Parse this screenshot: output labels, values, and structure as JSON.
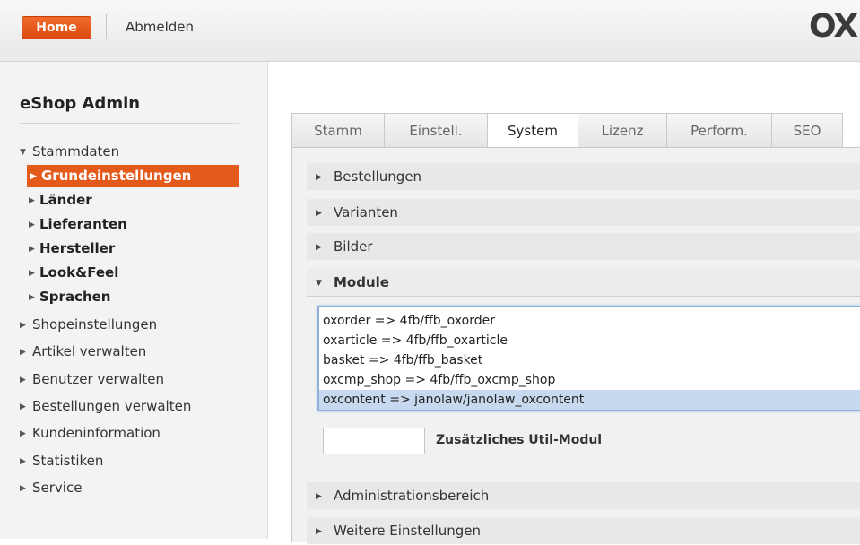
{
  "topbar": {
    "home_label": "Home",
    "logout_label": "Abmelden",
    "logo_text": "OX"
  },
  "sidebar": {
    "title": "eShop Admin",
    "section": {
      "label": "Stammdaten",
      "expanded": true
    },
    "sub_items": [
      {
        "label": "Grundeinstellungen",
        "active": true
      },
      {
        "label": "Länder"
      },
      {
        "label": "Lieferanten"
      },
      {
        "label": "Hersteller"
      },
      {
        "label": "Look&Feel"
      },
      {
        "label": "Sprachen"
      }
    ],
    "items": [
      {
        "label": "Shopeinstellungen"
      },
      {
        "label": "Artikel verwalten"
      },
      {
        "label": "Benutzer verwalten"
      },
      {
        "label": "Bestellungen verwalten"
      },
      {
        "label": "Kundeninformation"
      },
      {
        "label": "Statistiken"
      },
      {
        "label": "Service"
      }
    ]
  },
  "tabs": [
    {
      "label": "Stamm"
    },
    {
      "label": "Einstell."
    },
    {
      "label": "System",
      "active": true
    },
    {
      "label": "Lizenz"
    },
    {
      "label": "Perform."
    },
    {
      "label": "SEO"
    }
  ],
  "groups": {
    "bestellungen": "Bestellungen",
    "varianten": "Varianten",
    "bilder": "Bilder",
    "module": "Module",
    "administrationsbereich": "Administrationsbereich",
    "weitere": "Weitere Einstellungen"
  },
  "modules": {
    "lines": [
      "oxorder => 4fb/ffb_oxorder",
      "oxarticle => 4fb/ffb_oxarticle",
      "basket => 4fb/ffb_basket",
      "oxcmp_shop => 4fb/ffb_oxcmp_shop",
      "oxcontent => janolaw/janolaw_oxcontent"
    ],
    "selected_index": 4,
    "util_input_value": "",
    "util_label": "Zusätzliches Util-Modul"
  },
  "colors": {
    "accent": "#e35a1b",
    "selection": "#c7d9ee"
  }
}
